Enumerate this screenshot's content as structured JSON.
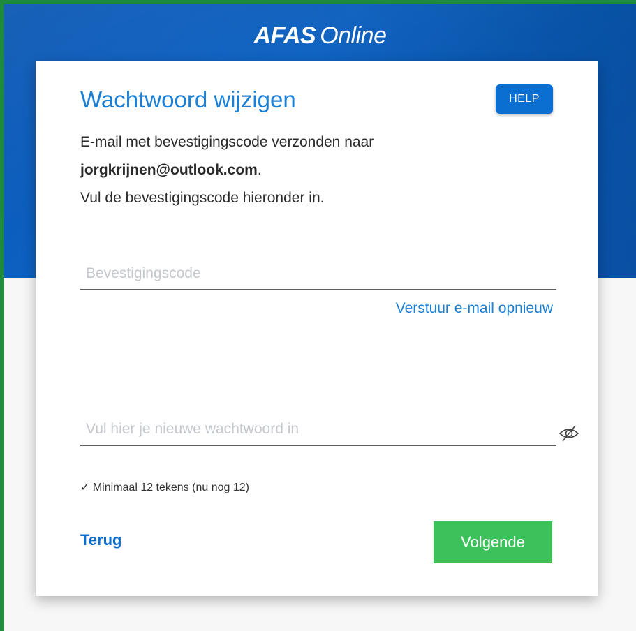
{
  "brand": {
    "part1": "AFAS",
    "part2": "Online"
  },
  "dialog": {
    "title": "Wachtwoord wijzigen",
    "help_label": "HELP",
    "message_line1": "E-mail met bevestigingscode verzonden naar",
    "email": "jorgkrijnen@outlook.com",
    "email_suffix": ".",
    "message_line3": "Vul de bevestigingscode hieronder in."
  },
  "code_field": {
    "placeholder": "Bevestigingscode",
    "value": ""
  },
  "resend_link": "Verstuur e-mail opnieuw",
  "password_field": {
    "placeholder": "Vul hier je nieuwe wachtwoord in",
    "value": ""
  },
  "toggle_visibility_icon": "eye-slash-icon",
  "requirement": "✓ Minimaal 12 tekens (nu nog 12)",
  "actions": {
    "back_label": "Terug",
    "next_label": "Volgende"
  },
  "colors": {
    "accent": "#1a7fd6",
    "banner": "#0a56b3",
    "primary_button": "#0b6fd1",
    "next_button": "#3dc15b",
    "outer_border": "#1e8a3c"
  }
}
